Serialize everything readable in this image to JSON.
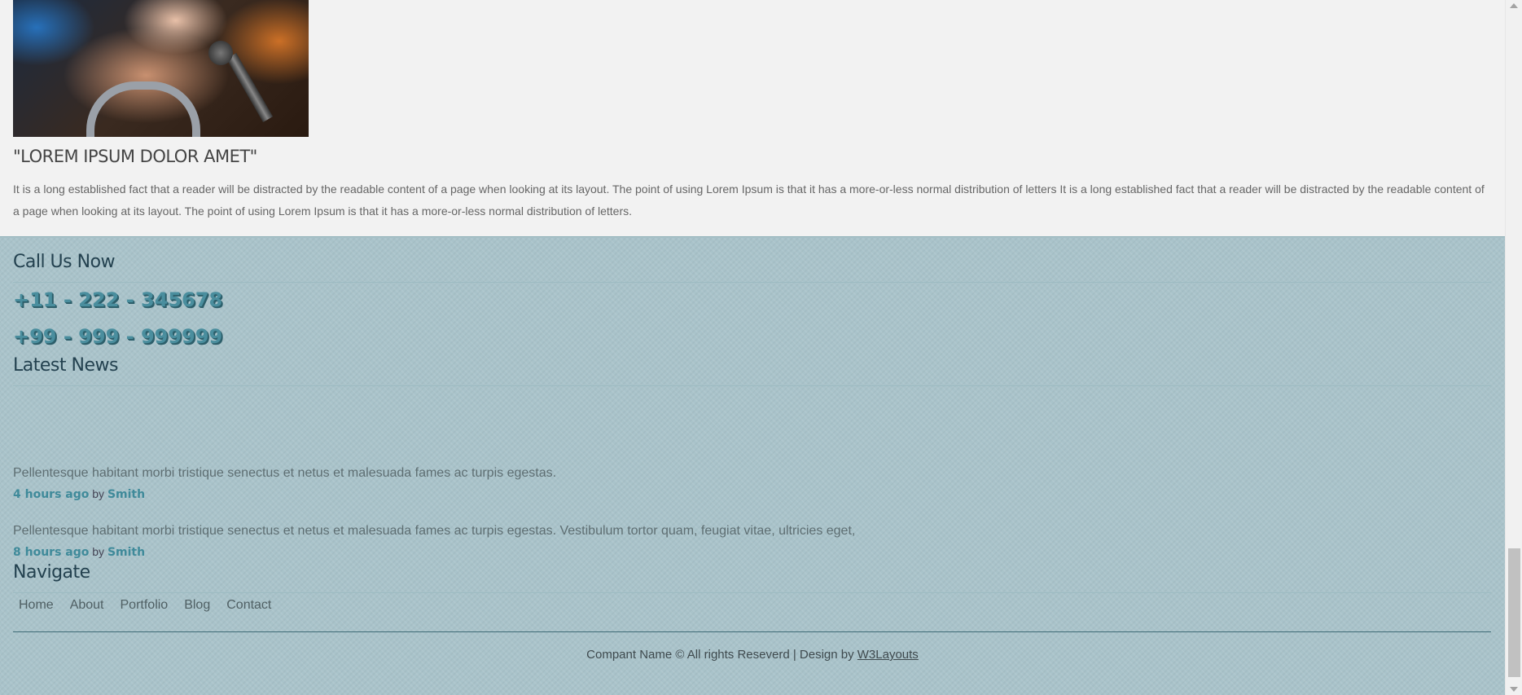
{
  "quote": {
    "title": "\"LOREM IPSUM DOLOR AMET\"",
    "body": "It is a long established fact that a reader will be distracted by the readable content of a page when looking at its layout. The point of using Lorem Ipsum is that it has a more-or-less normal distribution of letters It is a long established fact that a reader will be distracted by the readable content of a page when looking at its layout. The point of using Lorem Ipsum is that it has a more-or-less normal distribution of letters."
  },
  "footer": {
    "call_heading": "Call Us Now",
    "phones": [
      "+11 - 222 - 345678",
      "+99 - 999 - 999999"
    ],
    "news_heading": "Latest News",
    "news": [
      {
        "text": "Pellentesque habitant morbi tristique senectus et netus et malesuada fames ac turpis egestas.",
        "time": "4 hours ago",
        "by": "by",
        "author": "Smith"
      },
      {
        "text": "Pellentesque habitant morbi tristique senectus et netus et malesuada fames ac turpis egestas. Vestibulum tortor quam, feugiat vitae, ultricies eget,",
        "time": "8 hours ago",
        "by": "by",
        "author": "Smith"
      }
    ],
    "nav_heading": "Navigate",
    "nav": [
      "Home",
      "About",
      "Portfolio",
      "Blog",
      "Contact"
    ],
    "copyright_prefix": "Compant Name © All rights Reseverd | Design by",
    "copyright_link": "W3Layouts"
  },
  "colors": {
    "footer_bg": "#a9c3ca",
    "phone_accent": "#4a8e9e",
    "meta_accent": "#3f8a9a"
  }
}
